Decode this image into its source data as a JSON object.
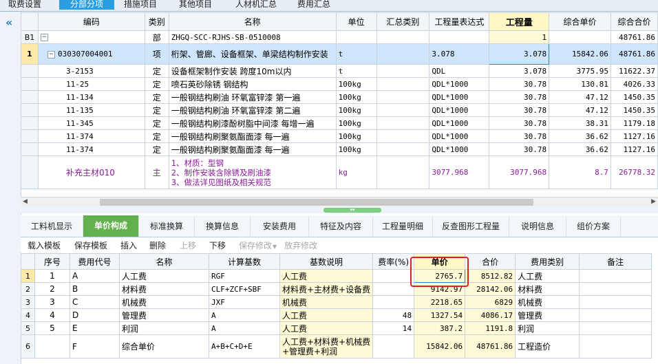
{
  "top_tabs": [
    "取费设置",
    "分部分项",
    "措施项目",
    "其他项目",
    "人材机汇总",
    "费用汇总"
  ],
  "upper": {
    "headers": [
      "编码",
      "类别",
      "名称",
      "单位",
      "汇总类别",
      "工程量表达式",
      "工程量",
      "综合单价",
      "综合合价"
    ],
    "section_row": {
      "gutter": "B1",
      "fold": "−",
      "type": "部",
      "name": "ZHGQ-SCC-RJHS-SB-0510008",
      "qty": "1",
      "total": "48761.86"
    },
    "item_row": {
      "gutter": "1",
      "fold": "−",
      "code": "030307004001",
      "type": "项",
      "name": "桁架、管廊、设备框架、单梁结构制作安装",
      "unit": "t",
      "expr": "3.078",
      "qty": "3.078",
      "unit_price": "15842.06",
      "total": "48761.86"
    },
    "rows": [
      {
        "code": "3-2153",
        "type": "定",
        "name": "设备框架制作安装 跨度10m以内",
        "unit": "t",
        "expr": "QDL",
        "qty": "3.078",
        "unit_price": "3775.95",
        "total": "11622.37"
      },
      {
        "code": "11-25",
        "type": "定",
        "name": "喷石英砂除锈 钢结构",
        "unit": "100kg",
        "expr": "QDL*1000",
        "qty": "30.78",
        "unit_price": "130.81",
        "total": "4026.33"
      },
      {
        "code": "11-134",
        "type": "定",
        "name": "一般钢结构刷油 环氧富锌漆 第一遍",
        "unit": "100kg",
        "expr": "QDL*1000",
        "qty": "30.78",
        "unit_price": "47.12",
        "total": "1450.35"
      },
      {
        "code": "11-135",
        "type": "定",
        "name": "一般钢结构刷油 环氧富锌漆 第二遍",
        "unit": "100kg",
        "expr": "QDL*1000",
        "qty": "30.78",
        "unit_price": "47.12",
        "total": "1450.35"
      },
      {
        "code": "11-345",
        "type": "定",
        "name": "一般钢结构刷漆酚树脂中间漆 每增一遍",
        "unit": "100kg",
        "expr": "QDL*1000",
        "qty": "30.78",
        "unit_price": "38.31",
        "total": "1179.18"
      },
      {
        "code": "11-374",
        "type": "定",
        "name": "一般钢结构刷聚氨酯面漆 每一遍",
        "unit": "100kg",
        "expr": "QDL*1000",
        "qty": "30.78",
        "unit_price": "36.62",
        "total": "1127.16"
      },
      {
        "code": "11-374",
        "type": "定",
        "name": "一般钢结构刷聚氨酯面漆 每一遍",
        "unit": "100kg",
        "expr": "QDL*1000",
        "qty": "30.78",
        "unit_price": "36.62",
        "total": "1127.16"
      }
    ],
    "material_row": {
      "code": "补充主材010",
      "type": "主",
      "name_lines": [
        "1、材质：型钢",
        "2、制作安装含除锈及刷油漆",
        "3、做法详见图纸及相关规范"
      ],
      "unit": "kg",
      "expr": "3077.968",
      "qty": "3077.968",
      "unit_price": "8.7",
      "total": "26778.32"
    }
  },
  "bottom_tabs": [
    "工料机显示",
    "单价构成",
    "标准换算",
    "换算信息",
    "安装费用",
    "特征及内容",
    "工程量明细",
    "反查图形工程量",
    "说明信息",
    "组价方案"
  ],
  "toolbar": [
    "载入模板",
    "保存模板",
    "插入",
    "删除",
    "上移",
    "下移",
    "保存修改",
    "放弃修改"
  ],
  "lower": {
    "headers": [
      "序号",
      "费用代号",
      "名称",
      "计算基数",
      "基数说明",
      "费率(%)",
      "单价",
      "合价",
      "费用类别",
      "备注"
    ],
    "rows": [
      {
        "gutter": "1",
        "seq": "1",
        "code": "A",
        "name": "人工费",
        "base": "RGF",
        "desc": "人工费",
        "rate": "",
        "price": "2765.7",
        "total": "8512.82",
        "category": "人工费"
      },
      {
        "gutter": "2",
        "seq": "2",
        "code": "B",
        "name": "材料费",
        "base": "CLF+ZCF+SBF",
        "desc": "材料费+主材费+设备费",
        "rate": "",
        "price": "9142.97",
        "total": "28142.06",
        "category": "材料费"
      },
      {
        "gutter": "3",
        "seq": "3",
        "code": "C",
        "name": "机械费",
        "base": "JXF",
        "desc": "机械费",
        "rate": "",
        "price": "2218.65",
        "total": "6829",
        "category": "机械费"
      },
      {
        "gutter": "4",
        "seq": "4",
        "code": "D",
        "name": "管理费",
        "base": "A",
        "desc": "人工费",
        "rate": "48",
        "price": "1327.54",
        "total": "4086.17",
        "category": "管理费"
      },
      {
        "gutter": "5",
        "seq": "5",
        "code": "E",
        "name": "利润",
        "base": "A",
        "desc": "人工费",
        "rate": "14",
        "price": "387.2",
        "total": "1191.8",
        "category": "利润"
      },
      {
        "gutter": "6",
        "seq": "",
        "code": "F",
        "name": "综合单价",
        "base": "A+B+C+D+E",
        "desc_lines": [
          "人工费+材料费+机械费",
          "+管理费+利润"
        ],
        "rate": "",
        "price": "15842.06",
        "total": "48761.86",
        "category": "工程造价"
      }
    ]
  },
  "colors": {
    "active_top_tab": "#2a9ee0",
    "active_bottom_tab": "#62b14c",
    "selected_row": "#cfe5fb",
    "material_text": "#8b1a9a",
    "highlight_box": "#e02020",
    "yellow_cell": "#fffbd6"
  }
}
